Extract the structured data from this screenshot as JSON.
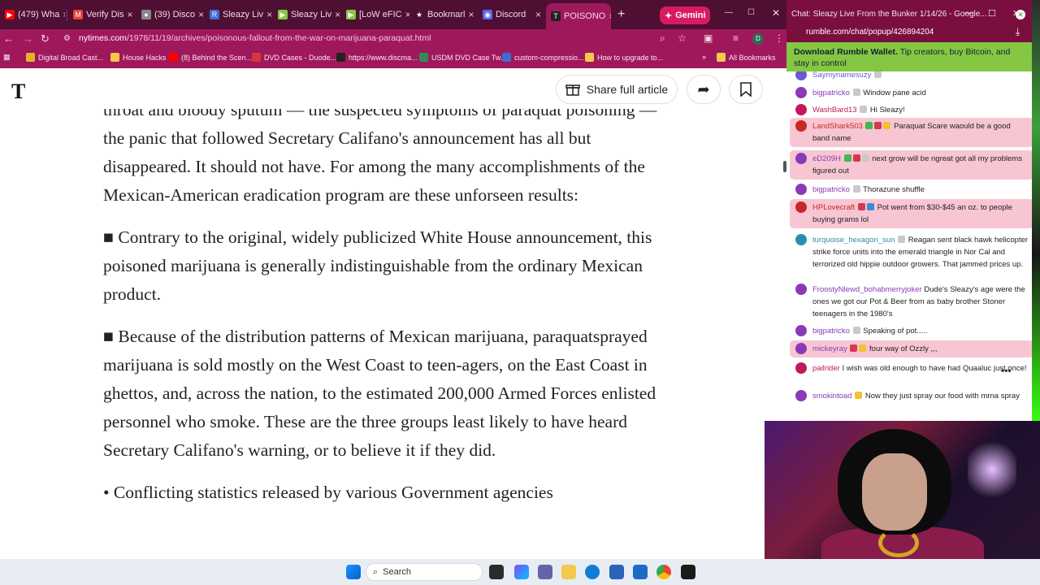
{
  "browser": {
    "tabs": [
      {
        "label": "(479) Wha",
        "icon": "youtube-icon",
        "color": "#ff0000"
      },
      {
        "label": "Verify Dis",
        "icon": "gmail-icon",
        "color": "#ea4335"
      },
      {
        "label": "(39) Disco",
        "icon": "github-icon",
        "color": "#888888"
      },
      {
        "label": "Sleazy Liv",
        "icon": "rumble-r-icon",
        "color": "#3d6cd6"
      },
      {
        "label": "Sleazy Liv",
        "icon": "rumble-icon",
        "color": "#85c742"
      },
      {
        "label": "[LoW eFIC",
        "icon": "rumble-icon",
        "color": "#85c742"
      },
      {
        "label": "Bookmarl",
        "icon": "star-icon",
        "color": "#ffffff"
      },
      {
        "label": "Discord",
        "icon": "discord-icon",
        "color": "#5865f2"
      },
      {
        "label": "POISONO",
        "icon": "nyt-icon",
        "color": "#222222"
      }
    ],
    "gemini_label": "Gemini",
    "url_host": "nytimes.com",
    "url_path": "/1978/11/19/archives/poisonous-fallout-from-the-war-on-marijuana-paraquat.html",
    "profile_initial": "D",
    "bookmarks": [
      {
        "label": "Digital Broad Cast...",
        "color": "#e6b422"
      },
      {
        "label": "House Hacks",
        "color": "#f2c94c"
      },
      {
        "label": "(8) Behind the Scen...",
        "color": "#ff0000"
      },
      {
        "label": "DVD Cases - Duode...",
        "color": "#d63737"
      },
      {
        "label": "https://www.discma...",
        "color": "#222222"
      },
      {
        "label": "USDM DVD Case Tw...",
        "color": "#2e8b57"
      },
      {
        "label": "custom-compressio...",
        "color": "#3d6cd6"
      },
      {
        "label": "How to upgrade to...",
        "color": "#f2c94c"
      }
    ],
    "all_bookmarks": "All Bookmarks"
  },
  "nyt": {
    "logo": "T",
    "share_label": "Share full article",
    "article_paragraphs": [
      "throat and bloody sputum — the suspected symptoms of paraquat poisoning — the panic that followed Secretary Califano's announcement has all but disappeared. It should not have. For among the many accomplishments of the Mexican-American eradication program are these unforseen results:",
      "■ Contrary to the original, widely publicized White House announcement, this poisoned marijuana is generally indistinguishable from the ordinary Mexican product.",
      "■ Because of the distribution patterns of Mexican marijuana, paraquatsprayed marijuana is sold mostly on the West Coast to teen-agers, on the East Coast in ghettos, and, across the nation, to the estimated 200,000 Armed Forces enlisted personnel who smoke. These are the three groups least likely to have heard Secretary Califano's warning, or to believe it if they did.",
      "• Conflicting statistics released by various Government agencies"
    ]
  },
  "chat": {
    "window_title": "Chat: Sleazy Live From the Bunker 1/14/26 - Google...",
    "url": "rumble.com/chat/popup/426894204",
    "wallet_title": "Download Rumble Wallet.",
    "wallet_text": "Tip creators, buy Bitcoin, and stay in control",
    "messages": [
      {
        "user": "Saymynamesuzy",
        "text": "",
        "ucolor": "#6a5acd",
        "hl": false,
        "badges": [
          "b-gray"
        ]
      },
      {
        "user": "bigpatricko",
        "text": "Window pane acid",
        "ucolor": "#8a3ab9",
        "hl": false,
        "badges": [
          "b-gray"
        ]
      },
      {
        "user": "WashBard13",
        "text": "Hi Sleazy!",
        "ucolor": "#c2185b",
        "hl": false,
        "badges": [
          "b-gray"
        ]
      },
      {
        "user": "LandShark503",
        "text": "Paraquat Scare waould be a good band name",
        "ucolor": "#c62828",
        "hl": true,
        "badges": [
          "b-grn",
          "b-red",
          "b-yel"
        ]
      },
      {
        "user": "eD209H",
        "text": "next grow will be ngreat got all my problems figured out",
        "ucolor": "#8a3ab9",
        "hl": true,
        "badges": [
          "b-grn",
          "b-red",
          "b-gray"
        ]
      },
      {
        "user": "bigpatricko",
        "text": "Thorazune shuffle",
        "ucolor": "#8a3ab9",
        "hl": false,
        "badges": [
          "b-gray"
        ]
      },
      {
        "user": "HPLovecraft",
        "text": "Pot went from $30-$45 an oz. to people buying grams lol",
        "ucolor": "#c62828",
        "hl": true,
        "badges": [
          "b-red",
          "b-blu"
        ]
      },
      {
        "user": "turquoise_hexagon_sun",
        "text": "Reagan sent black hawk helicopter strike force units into the emerald triangle in Nor Cal and terrorized old hippie outdoor growers. That jammed prices up.",
        "ucolor": "#2a8fa8",
        "hl": false,
        "badges": [
          "b-gray"
        ]
      },
      {
        "user": "FroostyNlewd_bohabmerryjoker",
        "text": "Dude's Sleazy's age were the ones we got our Pot & Beer from as baby brother Stoner teenagers in the 1980's",
        "ucolor": "#8a3ab9",
        "hl": false,
        "badges": []
      },
      {
        "user": "bigpatricko",
        "text": "Speaking of pot.....",
        "ucolor": "#8a3ab9",
        "hl": false,
        "badges": [
          "b-gray"
        ]
      },
      {
        "user": "mickeyray",
        "text": "four way of Ozzly ,,,",
        "ucolor": "#8a3ab9",
        "hl": true,
        "badges": [
          "b-red",
          "b-yel"
        ]
      },
      {
        "user": "pailrider",
        "text": "I wish was old enough to have had Quaaluc just once!",
        "ucolor": "#c2185b",
        "hl": false,
        "badges": []
      },
      {
        "user": "smokintoad",
        "text": "Now they just spray our food with mrna spray",
        "ucolor": "#8a3ab9",
        "hl": false,
        "badges": [
          "b-yel"
        ]
      }
    ]
  },
  "taskbar": {
    "search_label": "Search"
  }
}
